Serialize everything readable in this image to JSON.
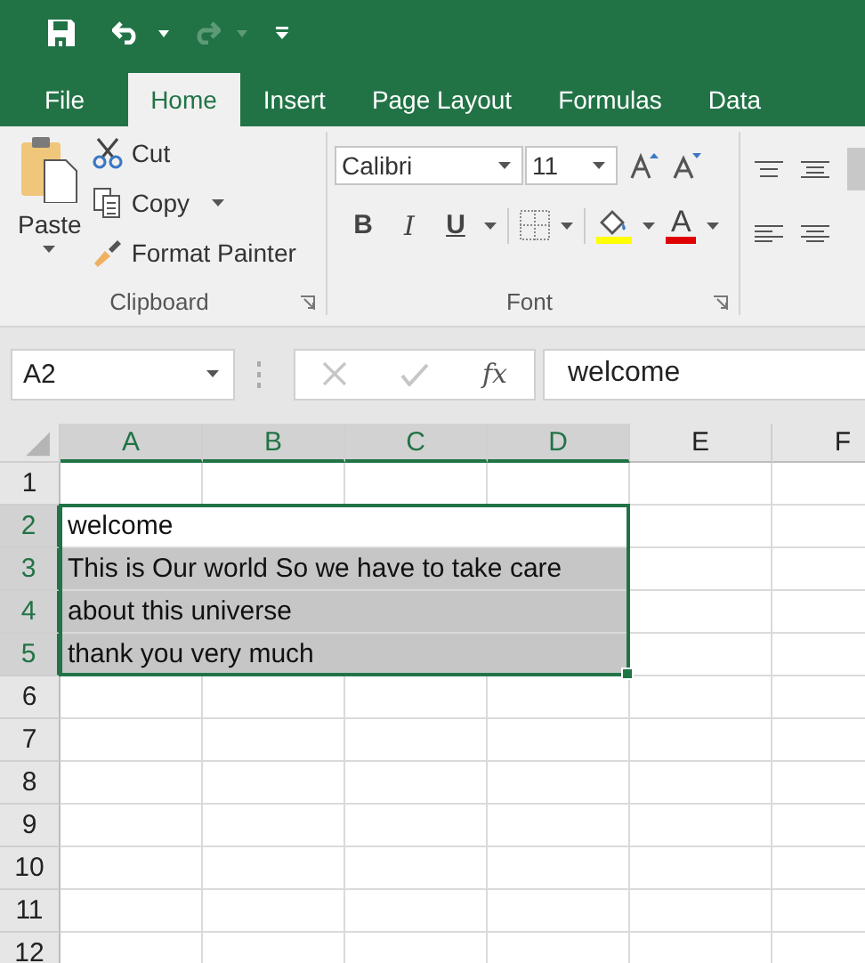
{
  "tabs": [
    {
      "label": "File",
      "selected": false
    },
    {
      "label": "Home",
      "selected": true
    },
    {
      "label": "Insert",
      "selected": false
    },
    {
      "label": "Page Layout",
      "selected": false
    },
    {
      "label": "Formulas",
      "selected": false
    },
    {
      "label": "Data",
      "selected": false
    }
  ],
  "clipboard": {
    "paste": "Paste",
    "cut": "Cut",
    "copy": "Copy",
    "format_painter": "Format Painter",
    "group": "Clipboard"
  },
  "font": {
    "name": "Calibri",
    "size": "11",
    "bold": "B",
    "italic": "I",
    "underline": "U",
    "font_color": "A",
    "group": "Font"
  },
  "formula_bar": {
    "name_box": "A2",
    "fx": "fx",
    "value": "welcome"
  },
  "columns": [
    {
      "label": "A",
      "selected": true
    },
    {
      "label": "B",
      "selected": true
    },
    {
      "label": "C",
      "selected": true
    },
    {
      "label": "D",
      "selected": true
    },
    {
      "label": "E",
      "selected": false
    },
    {
      "label": "F",
      "selected": false
    }
  ],
  "rows": [
    {
      "label": "1",
      "selected": false,
      "highlighted": false
    },
    {
      "label": "2",
      "selected": true,
      "highlighted": false,
      "text": "welcome"
    },
    {
      "label": "3",
      "selected": true,
      "highlighted": true,
      "text": "This is Our world So we have to take care"
    },
    {
      "label": "4",
      "selected": true,
      "highlighted": true,
      "text": "about this universe"
    },
    {
      "label": "5",
      "selected": true,
      "highlighted": true,
      "text": "thank you very much"
    },
    {
      "label": "6",
      "selected": false,
      "highlighted": false
    },
    {
      "label": "7",
      "selected": false,
      "highlighted": false
    },
    {
      "label": "8",
      "selected": false,
      "highlighted": false
    },
    {
      "label": "9",
      "selected": false,
      "highlighted": false
    },
    {
      "label": "10",
      "selected": false,
      "highlighted": false
    },
    {
      "label": "11",
      "selected": false,
      "highlighted": false
    },
    {
      "label": "12",
      "selected": false,
      "highlighted": false
    }
  ]
}
